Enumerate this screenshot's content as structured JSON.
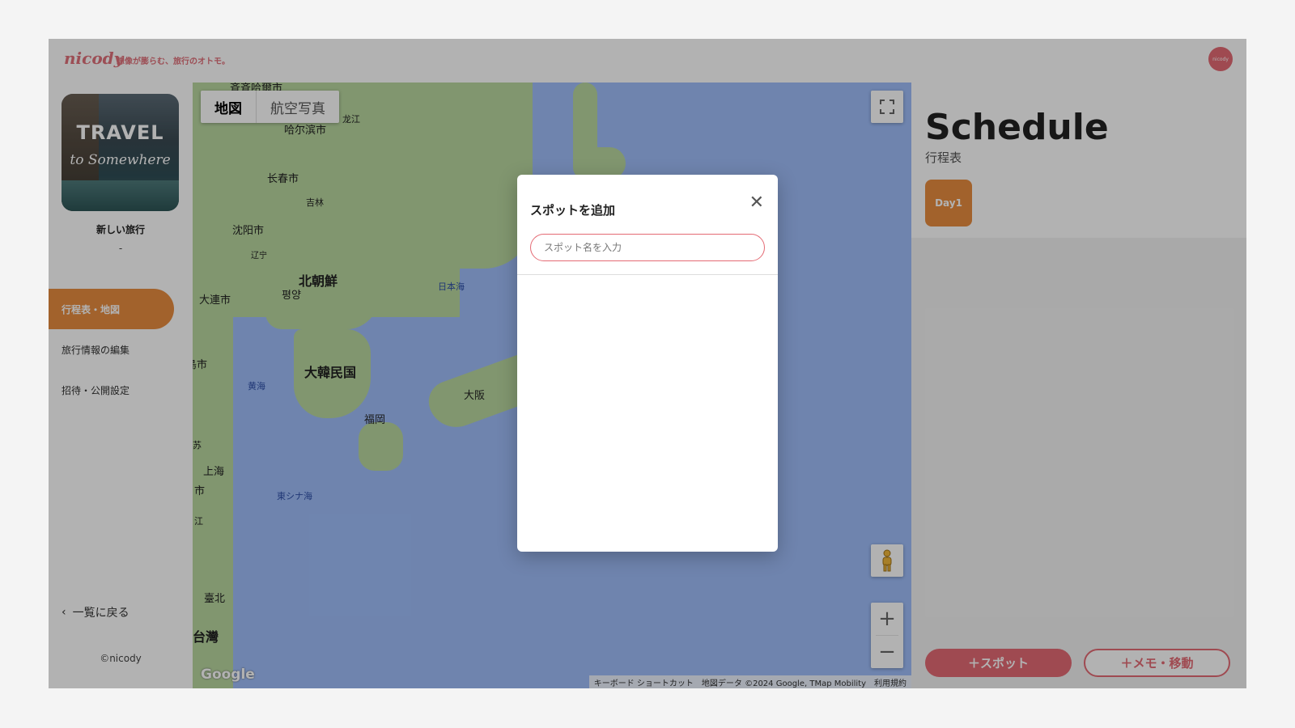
{
  "header": {
    "logo": "nicody",
    "tagline": "想像が膨らむ、旅行のオトモ。",
    "avatar_text": "nicody"
  },
  "sidebar": {
    "cover": {
      "title_line1": "TRAVEL",
      "title_line2": "to Somewhere"
    },
    "trip_name": "新しい旅行",
    "trip_date": "-",
    "nav": [
      {
        "label": "行程表・地図",
        "active": true
      },
      {
        "label": "旅行情報の編集",
        "active": false
      },
      {
        "label": "招待・公開設定",
        "active": false
      }
    ],
    "back_label": "一覧に戻る",
    "copyright": "©nicody"
  },
  "map": {
    "type_buttons": [
      "地図",
      "航空写真"
    ],
    "labels": {
      "qiqihar": "斉斉哈爾市",
      "harbin": "哈尔滨市",
      "heilongjiang": "龙江",
      "changchun": "长春市",
      "jilin": "吉林",
      "shenyang": "沈阳市",
      "liaoning": "辽宁",
      "north_korea": "北朝鮮",
      "pyongyang": "평양",
      "dalian": "大連市",
      "sea_of_japan": "日本海",
      "south_korea": "大韓民国",
      "yellow_sea": "黄海",
      "city_fragment": "島市",
      "fukuoka": "福岡",
      "osaka": "大阪",
      "jiangsu": "苏",
      "shanghai": "上海",
      "shi": "市",
      "zhejiang": "江",
      "east_china_sea": "東シナ海",
      "taipei": "臺北",
      "taiwan": "台灣"
    },
    "google_logo": "Google",
    "attribution": [
      "キーボード ショートカット",
      "地図データ ©2024 Google, TMap Mobility",
      "利用規約"
    ],
    "icons": {
      "fullscreen": "fullscreen-icon",
      "pegman": "pegman-icon",
      "zoom_in": "+",
      "zoom_out": "−"
    }
  },
  "schedule": {
    "title": "Schedule",
    "subtitle": "行程表",
    "day_tab": "Day1",
    "add_spot_button": "＋スポット",
    "add_memo_button": "＋メモ・移動"
  },
  "modal": {
    "title": "スポットを追加",
    "close_symbol": "✕",
    "search_placeholder": "スポット名を入力",
    "search_value": ""
  },
  "colors": {
    "accent_orange": "#e88d3f",
    "accent_pink": "#e46a74",
    "sea": "#9fbefa",
    "land": "#b9d7a0"
  }
}
